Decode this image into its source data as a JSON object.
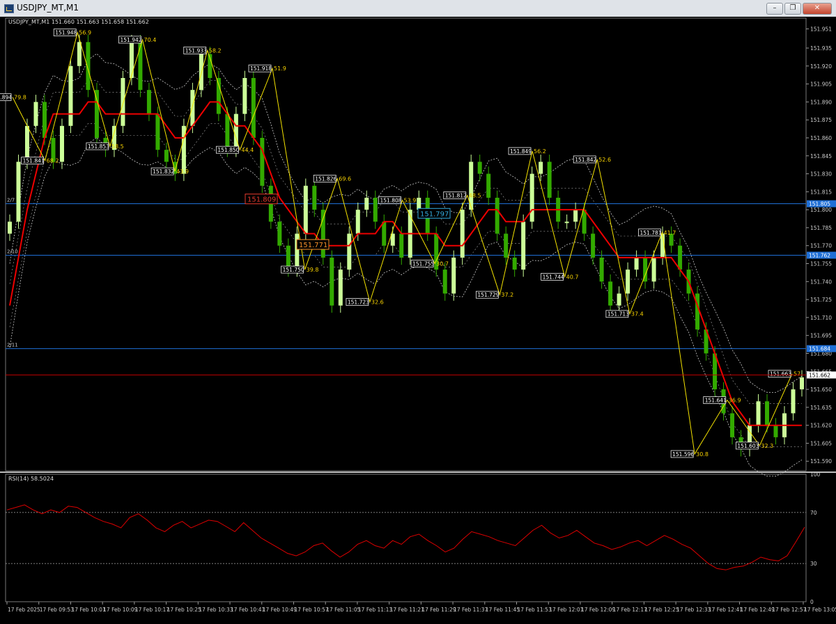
{
  "window": {
    "title": "USDJPY_MT,M1",
    "minimize_label": "–",
    "restore_label": "❐",
    "close_label": "✕"
  },
  "main_header": "USDJPY_MT,M1  151.660 151.663 151.658 151.662",
  "rsi_header": "RSI(14) 58.5024",
  "colors": {
    "up_candle": "#ccff99",
    "down_candle": "#33aa00",
    "ma": "#ee0000",
    "zigzag": "#f5e300",
    "bands": "#cccccc",
    "hline": "#1f6fd6",
    "rsi": "#dd0000",
    "price_line": "#c00000"
  },
  "chart_data": [
    {
      "type": "line",
      "title": "USDJPY_MT,M1",
      "y_ticks": [
        "151.951",
        "151.935",
        "151.920",
        "151.905",
        "151.890",
        "151.875",
        "151.860",
        "151.845",
        "151.830",
        "151.815",
        "151.800",
        "151.785",
        "151.770",
        "151.755",
        "151.740",
        "151.725",
        "151.710",
        "151.695",
        "151.680",
        "151.665",
        "151.650",
        "151.635",
        "151.620",
        "151.605",
        "151.590"
      ],
      "ylim": [
        151.582,
        151.96
      ],
      "x_tick_labels": [
        "17 Feb 2025",
        "17 Feb 09:53",
        "17 Feb 10:01",
        "17 Feb 10:09",
        "17 Feb 10:17",
        "17 Feb 10:25",
        "17 Feb 10:33",
        "17 Feb 10:41",
        "17 Feb 10:49",
        "17 Feb 10:57",
        "17 Feb 11:05",
        "17 Feb 11:13",
        "17 Feb 11:21",
        "17 Feb 11:29",
        "17 Feb 11:37",
        "17 Feb 11:45",
        "17 Feb 11:53",
        "17 Feb 12:01",
        "17 Feb 12:09",
        "17 Feb 12:17",
        "17 Feb 12:25",
        "17 Feb 12:33",
        "17 Feb 12:41",
        "17 Feb 12:49",
        "17 Feb 12:57",
        "17 Feb 13:05"
      ],
      "x_tick_count": 26,
      "series": [
        {
          "name": "Close",
          "values": [
            151.79,
            151.84,
            151.87,
            151.89,
            151.86,
            151.84,
            151.87,
            151.92,
            151.94,
            151.9,
            151.86,
            151.85,
            151.87,
            151.91,
            151.94,
            151.9,
            151.88,
            151.85,
            151.84,
            151.83,
            151.87,
            151.9,
            151.93,
            151.91,
            151.88,
            151.85,
            151.88,
            151.91,
            151.86,
            151.82,
            151.79,
            151.77,
            151.75,
            151.78,
            151.82,
            151.8,
            151.76,
            151.72,
            151.75,
            151.78,
            151.8,
            151.81,
            151.79,
            151.77,
            151.78,
            151.76,
            151.8,
            151.81,
            151.78,
            151.75,
            151.73,
            151.76,
            151.8,
            151.84,
            151.83,
            151.81,
            151.78,
            151.76,
            151.75,
            151.79,
            151.83,
            151.84,
            151.81,
            151.79,
            151.79,
            151.8,
            151.78,
            151.76,
            151.74,
            151.72,
            151.73,
            151.75,
            151.76,
            151.74,
            151.76,
            151.78,
            151.77,
            151.75,
            151.73,
            151.7,
            151.68,
            151.65,
            151.63,
            151.61,
            151.6,
            151.62,
            151.64,
            151.62,
            151.61,
            151.63,
            151.65,
            151.66
          ]
        },
        {
          "name": "MA",
          "values": [
            151.72,
            151.76,
            151.8,
            151.83,
            151.86,
            151.88,
            151.88,
            151.88,
            151.88,
            151.89,
            151.89,
            151.88,
            151.88,
            151.88,
            151.88,
            151.88,
            151.88,
            151.88,
            151.87,
            151.86,
            151.86,
            151.87,
            151.88,
            151.89,
            151.89,
            151.88,
            151.87,
            151.87,
            151.86,
            151.85,
            151.83,
            151.81,
            151.8,
            151.79,
            151.78,
            151.78,
            151.77,
            151.77,
            151.77,
            151.77,
            151.78,
            151.78,
            151.78,
            151.79,
            151.79,
            151.78,
            151.78,
            151.78,
            151.78,
            151.78,
            151.77,
            151.77,
            151.77,
            151.78,
            151.79,
            151.8,
            151.8,
            151.79,
            151.79,
            151.79,
            151.8,
            151.8,
            151.8,
            151.8,
            151.8,
            151.8,
            151.8,
            151.79,
            151.78,
            151.77,
            151.76,
            151.76,
            151.76,
            151.76,
            151.76,
            151.76,
            151.76,
            151.75,
            151.74,
            151.72,
            151.7,
            151.68,
            151.66,
            151.64,
            151.63,
            151.62,
            151.62,
            151.62,
            151.62,
            151.62,
            151.62,
            151.62
          ]
        }
      ],
      "zigzag_labels": [
        {
          "price": "151.894",
          "pct": "79.8"
        },
        {
          "price": "151.841",
          "pct": "68.2"
        },
        {
          "price": "151.948",
          "pct": "56.9"
        },
        {
          "price": "151.853",
          "pct": "58.5"
        },
        {
          "price": "151.942",
          "pct": "70.4"
        },
        {
          "price": "151.832",
          "pct": "43.9"
        },
        {
          "price": "151.933",
          "pct": "58.2"
        },
        {
          "price": "151.850",
          "pct": "44.4"
        },
        {
          "price": "151.918",
          "pct": "51.9"
        },
        {
          "price": "151.750",
          "pct": "39.8"
        },
        {
          "price": "151.826",
          "pct": "69.6"
        },
        {
          "price": "151.723",
          "pct": "32.6"
        },
        {
          "price": "151.808",
          "pct": "53.9"
        },
        {
          "price": "151.755",
          "pct": "30.7"
        },
        {
          "price": "151.812",
          "pct": "48.5"
        },
        {
          "price": "151.729",
          "pct": "37.2"
        },
        {
          "price": "151.849",
          "pct": "56.2"
        },
        {
          "price": "151.744",
          "pct": "40.7"
        },
        {
          "price": "151.842",
          "pct": "52.6"
        },
        {
          "price": "151.713",
          "pct": "37.4"
        },
        {
          "price": "151.781",
          "pct": "41.7"
        },
        {
          "price": "151.596",
          "pct": "30.8"
        },
        {
          "price": "151.641",
          "pct": "36.9"
        },
        {
          "price": "151.603",
          "pct": "32.3"
        },
        {
          "price": "151.663",
          "pct": "57"
        }
      ],
      "annotations": [
        {
          "text": "151.809",
          "color": "#e63a2e"
        },
        {
          "text": "151.771",
          "color": "#f5902a"
        },
        {
          "text": "151.797",
          "color": "#33aadd"
        }
      ],
      "horizontal_lines": [
        {
          "label": "2/7",
          "price": "151.805"
        },
        {
          "label": "2/10",
          "price": "151.762"
        },
        {
          "label": "2/11",
          "price": "151.684"
        }
      ],
      "current_price": "151.662"
    },
    {
      "type": "line",
      "title": "RSI(14) 58.5024",
      "ylim": [
        0,
        100
      ],
      "y_ticks": [
        "100",
        "70",
        "30",
        "0"
      ],
      "levels": [
        70,
        30
      ],
      "series": [
        {
          "name": "RSI",
          "values": [
            72,
            74,
            76,
            72,
            69,
            72,
            70,
            75,
            74,
            70,
            66,
            63,
            61,
            58,
            66,
            69,
            64,
            58,
            55,
            60,
            63,
            58,
            61,
            64,
            63,
            59,
            55,
            62,
            56,
            50,
            46,
            42,
            38,
            36,
            39,
            44,
            46,
            40,
            35,
            39,
            45,
            48,
            44,
            42,
            48,
            45,
            51,
            53,
            48,
            44,
            39,
            42,
            49,
            55,
            53,
            51,
            48,
            46,
            44,
            50,
            56,
            60,
            54,
            50,
            52,
            56,
            51,
            46,
            44,
            41,
            43,
            46,
            48,
            44,
            48,
            52,
            49,
            45,
            42,
            36,
            30,
            26,
            25,
            27,
            28,
            31,
            35,
            33,
            32,
            36,
            47,
            58.5
          ]
        }
      ]
    }
  ]
}
